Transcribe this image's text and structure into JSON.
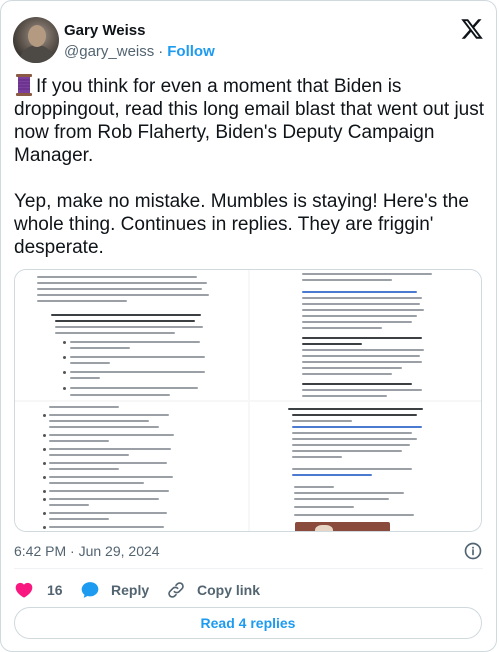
{
  "author": {
    "display_name": "Gary Weiss",
    "handle": "@gary_weiss",
    "separator": "·",
    "follow_label": "Follow"
  },
  "tweet": {
    "text": "If you think for even a moment that Biden is droppingout, read this long email blast that went out just now from Rob Flaherty, Biden's Deputy Campaign Manager.\n\nYep, make no mistake. Mumbles is staying! Here's the whole thing. Continues in replies. They are friggin' desperate.",
    "leading_emoji": "spool-of-thread-icon"
  },
  "meta": {
    "time": "6:42 PM",
    "separator": "·",
    "date": "Jun 29, 2024"
  },
  "actions": {
    "like_count": "16",
    "reply_label": "Reply",
    "copy_label": "Copy link"
  },
  "read_replies_label": "Read 4 replies",
  "colors": {
    "accent": "#1d9bf0",
    "like": "#f91880",
    "secondary_text": "#536471",
    "border": "#cfd9de"
  }
}
